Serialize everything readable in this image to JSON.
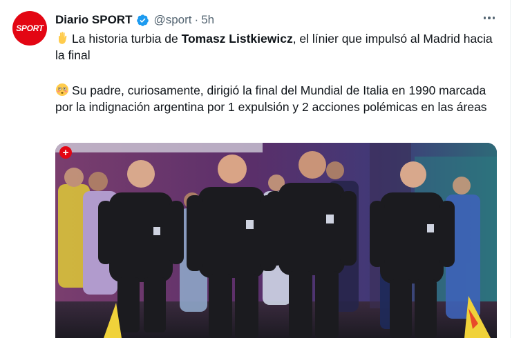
{
  "tweet": {
    "author": {
      "name": "Diario SPORT",
      "handle": "@sport",
      "separator": "·",
      "time": "5h",
      "avatar_text": "SPORT",
      "avatar_color": "#e30613",
      "verified_color": "#1d9bf0"
    },
    "paragraph1": {
      "emoji": "raised-hand-emoji",
      "before": "La historia turbia de ",
      "bold": "Tomasz Listkiewicz",
      "after": ", el línier que impulsó al Madrid hacia la final"
    },
    "paragraph2": {
      "emoji": "flushed-face-emoji",
      "text": "Su padre, curiosamente, dirigió la final del Mundial de Italia en 1990 marcada por la indignación argentina por 1 expulsión y 2 acciones polémicas en las áreas"
    },
    "media": {
      "plus_label": "+",
      "description_icon": "photo-referees-walking-out"
    }
  }
}
